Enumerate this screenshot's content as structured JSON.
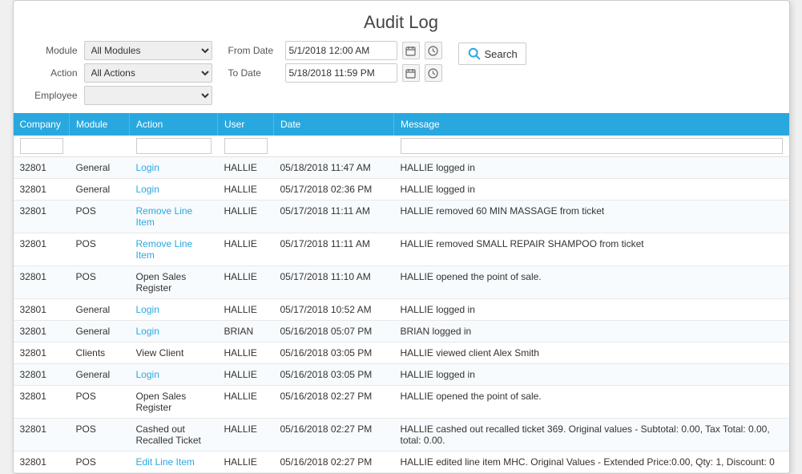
{
  "title": "Audit Log",
  "filters": {
    "module_label": "Module",
    "action_label": "Action",
    "employee_label": "Employee",
    "module_value": "All Modules",
    "action_value": "All Actions",
    "employee_value": "",
    "from_date_label": "From Date",
    "to_date_label": "To Date",
    "from_date_value": "5/1/2018 12:00 AM",
    "to_date_value": "5/18/2018 11:59 PM",
    "search_label": "Search"
  },
  "table": {
    "columns": [
      "Company",
      "Module",
      "Action",
      "User",
      "Date",
      "Message"
    ],
    "rows": [
      {
        "company": "32801",
        "module": "General",
        "action": "Login",
        "user": "HALLIE",
        "date": "05/18/2018 11:47 AM",
        "message": "HALLIE logged in",
        "action_link": true
      },
      {
        "company": "32801",
        "module": "General",
        "action": "Login",
        "user": "HALLIE",
        "date": "05/17/2018 02:36 PM",
        "message": "HALLIE logged in",
        "action_link": true
      },
      {
        "company": "32801",
        "module": "POS",
        "action": "Remove Line Item",
        "user": "HALLIE",
        "date": "05/17/2018 11:11 AM",
        "message": "HALLIE removed 60 MIN MASSAGE from ticket",
        "action_link": true
      },
      {
        "company": "32801",
        "module": "POS",
        "action": "Remove Line Item",
        "user": "HALLIE",
        "date": "05/17/2018 11:11 AM",
        "message": "HALLIE removed SMALL REPAIR SHAMPOO from ticket",
        "action_link": true
      },
      {
        "company": "32801",
        "module": "POS",
        "action": "Open Sales Register",
        "user": "HALLIE",
        "date": "05/17/2018 11:10 AM",
        "message": "HALLIE opened the point of sale.",
        "action_link": false
      },
      {
        "company": "32801",
        "module": "General",
        "action": "Login",
        "user": "HALLIE",
        "date": "05/17/2018 10:52 AM",
        "message": "HALLIE logged in",
        "action_link": true
      },
      {
        "company": "32801",
        "module": "General",
        "action": "Login",
        "user": "BRIAN",
        "date": "05/16/2018 05:07 PM",
        "message": "BRIAN logged in",
        "action_link": true
      },
      {
        "company": "32801",
        "module": "Clients",
        "action": "View Client",
        "user": "HALLIE",
        "date": "05/16/2018 03:05 PM",
        "message": "HALLIE viewed client Alex Smith",
        "action_link": false
      },
      {
        "company": "32801",
        "module": "General",
        "action": "Login",
        "user": "HALLIE",
        "date": "05/16/2018 03:05 PM",
        "message": "HALLIE logged in",
        "action_link": true
      },
      {
        "company": "32801",
        "module": "POS",
        "action": "Open Sales Register",
        "user": "HALLIE",
        "date": "05/16/2018 02:27 PM",
        "message": "HALLIE opened the point of sale.",
        "action_link": false
      },
      {
        "company": "32801",
        "module": "POS",
        "action": "Cashed out Recalled Ticket",
        "user": "HALLIE",
        "date": "05/16/2018 02:27 PM",
        "message": "HALLIE cashed out recalled ticket 369. Original values - Subtotal: 0.00, Tax Total: 0.00, total: 0.00.",
        "action_link": false
      },
      {
        "company": "32801",
        "module": "POS",
        "action": "Edit Line Item",
        "user": "HALLIE",
        "date": "05/16/2018 02:27 PM",
        "message": "HALLIE edited line item MHC. Original Values - Extended Price:0.00, Qty: 1, Discount: 0",
        "action_link": true
      }
    ]
  }
}
